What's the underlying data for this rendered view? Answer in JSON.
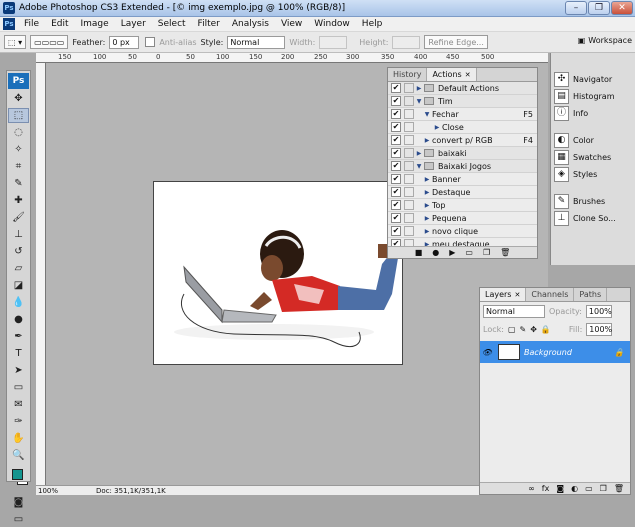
{
  "window": {
    "title": "Adobe Photoshop CS3 Extended - [© img exemplo.jpg @ 100% (RGB/8)]",
    "app_icon": "Ps"
  },
  "menu": [
    "File",
    "Edit",
    "Image",
    "Layer",
    "Select",
    "Filter",
    "Analysis",
    "View",
    "Window",
    "Help"
  ],
  "options": {
    "feather_label": "Feather:",
    "feather_value": "0 px",
    "antialias_label": "Anti-alias",
    "style_label": "Style:",
    "style_value": "Normal",
    "width_label": "Width:",
    "height_label": "Height:",
    "refine_label": "Refine Edge...",
    "workspace_label": "Workspace"
  },
  "toolbox": {
    "logo": "Ps",
    "fg_color": "#14958f",
    "bg_color": "#ffffff"
  },
  "rulers": {
    "top": [
      "150",
      "100",
      "50",
      "0",
      "50",
      "100",
      "150",
      "200",
      "250",
      "300",
      "350",
      "400",
      "450",
      "500"
    ]
  },
  "status": {
    "zoom": "100%",
    "doc": "Doc: 351,1K/351,1K"
  },
  "actions_panel": {
    "tabs": [
      "History",
      "Actions"
    ],
    "rows": [
      {
        "label": "Default Actions",
        "kind": "set",
        "expanded": false,
        "key": ""
      },
      {
        "label": "Tim",
        "kind": "set",
        "expanded": true,
        "key": ""
      },
      {
        "label": "Fechar",
        "kind": "action",
        "expanded": true,
        "key": "F5"
      },
      {
        "label": "Close",
        "kind": "command",
        "expanded": false,
        "key": ""
      },
      {
        "label": "convert p/ RGB",
        "kind": "action",
        "expanded": false,
        "key": "F4"
      },
      {
        "label": "baixaki",
        "kind": "set",
        "expanded": false,
        "key": ""
      },
      {
        "label": "Baixaki Jogos",
        "kind": "set",
        "expanded": true,
        "key": ""
      },
      {
        "label": "Banner",
        "kind": "action",
        "expanded": false,
        "key": ""
      },
      {
        "label": "Destaque",
        "kind": "action",
        "expanded": false,
        "key": ""
      },
      {
        "label": "Top",
        "kind": "action",
        "expanded": false,
        "key": ""
      },
      {
        "label": "Pequena",
        "kind": "action",
        "expanded": false,
        "key": ""
      },
      {
        "label": "novo clique",
        "kind": "action",
        "expanded": false,
        "key": ""
      },
      {
        "label": "meu destaque",
        "kind": "action",
        "expanded": false,
        "key": ""
      }
    ]
  },
  "dock": {
    "group1": [
      "Navigator",
      "Histogram",
      "Info"
    ],
    "group2": [
      "Color",
      "Swatches",
      "Styles"
    ],
    "group3": [
      "Brushes",
      "Clone So..."
    ]
  },
  "layers_panel": {
    "tabs": [
      "Layers",
      "Channels",
      "Paths"
    ],
    "blend_mode": "Normal",
    "opacity_label": "Opacity:",
    "opacity_value": "100%",
    "lock_label": "Lock:",
    "fill_label": "Fill:",
    "fill_value": "100%",
    "layer_name": "Background",
    "selected_color": "#3d8ee8"
  }
}
